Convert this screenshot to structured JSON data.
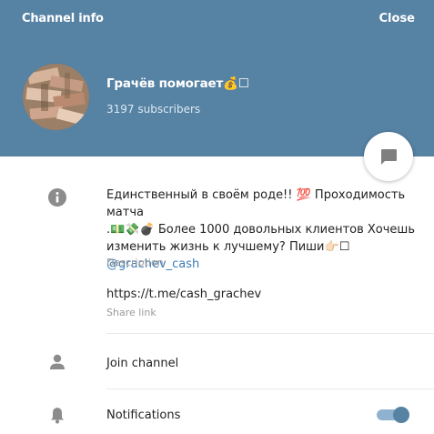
{
  "header": {
    "title": "Channel info",
    "close_label": "Close"
  },
  "channel": {
    "name": "Грачёв помогает💰☐",
    "subscribers": "3197 subscribers"
  },
  "info": {
    "description_line1": "Единственный в своём роде!! 💯  Проходимость матча",
    "description_line2": ".💵💸💣 Более 1000 довольных клиентов Хочешь",
    "description_line3": "изменить жизнь к лучшему? Пиши👉🏻☐",
    "description_handle": "@grachev_cash",
    "description_caption": "Description",
    "share_link": "https://t.me/cash_grachev",
    "share_link_caption": "Share link"
  },
  "actions": {
    "join_label": "Join channel",
    "notifications_label": "Notifications",
    "notifications_enabled": true
  },
  "colors": {
    "header_bg": "#5682a3",
    "accent": "#5682a3",
    "link": "#3a7bb6"
  },
  "icons": {
    "info": "info-icon",
    "user": "user-icon",
    "bell": "bell-icon",
    "message": "message-icon"
  }
}
